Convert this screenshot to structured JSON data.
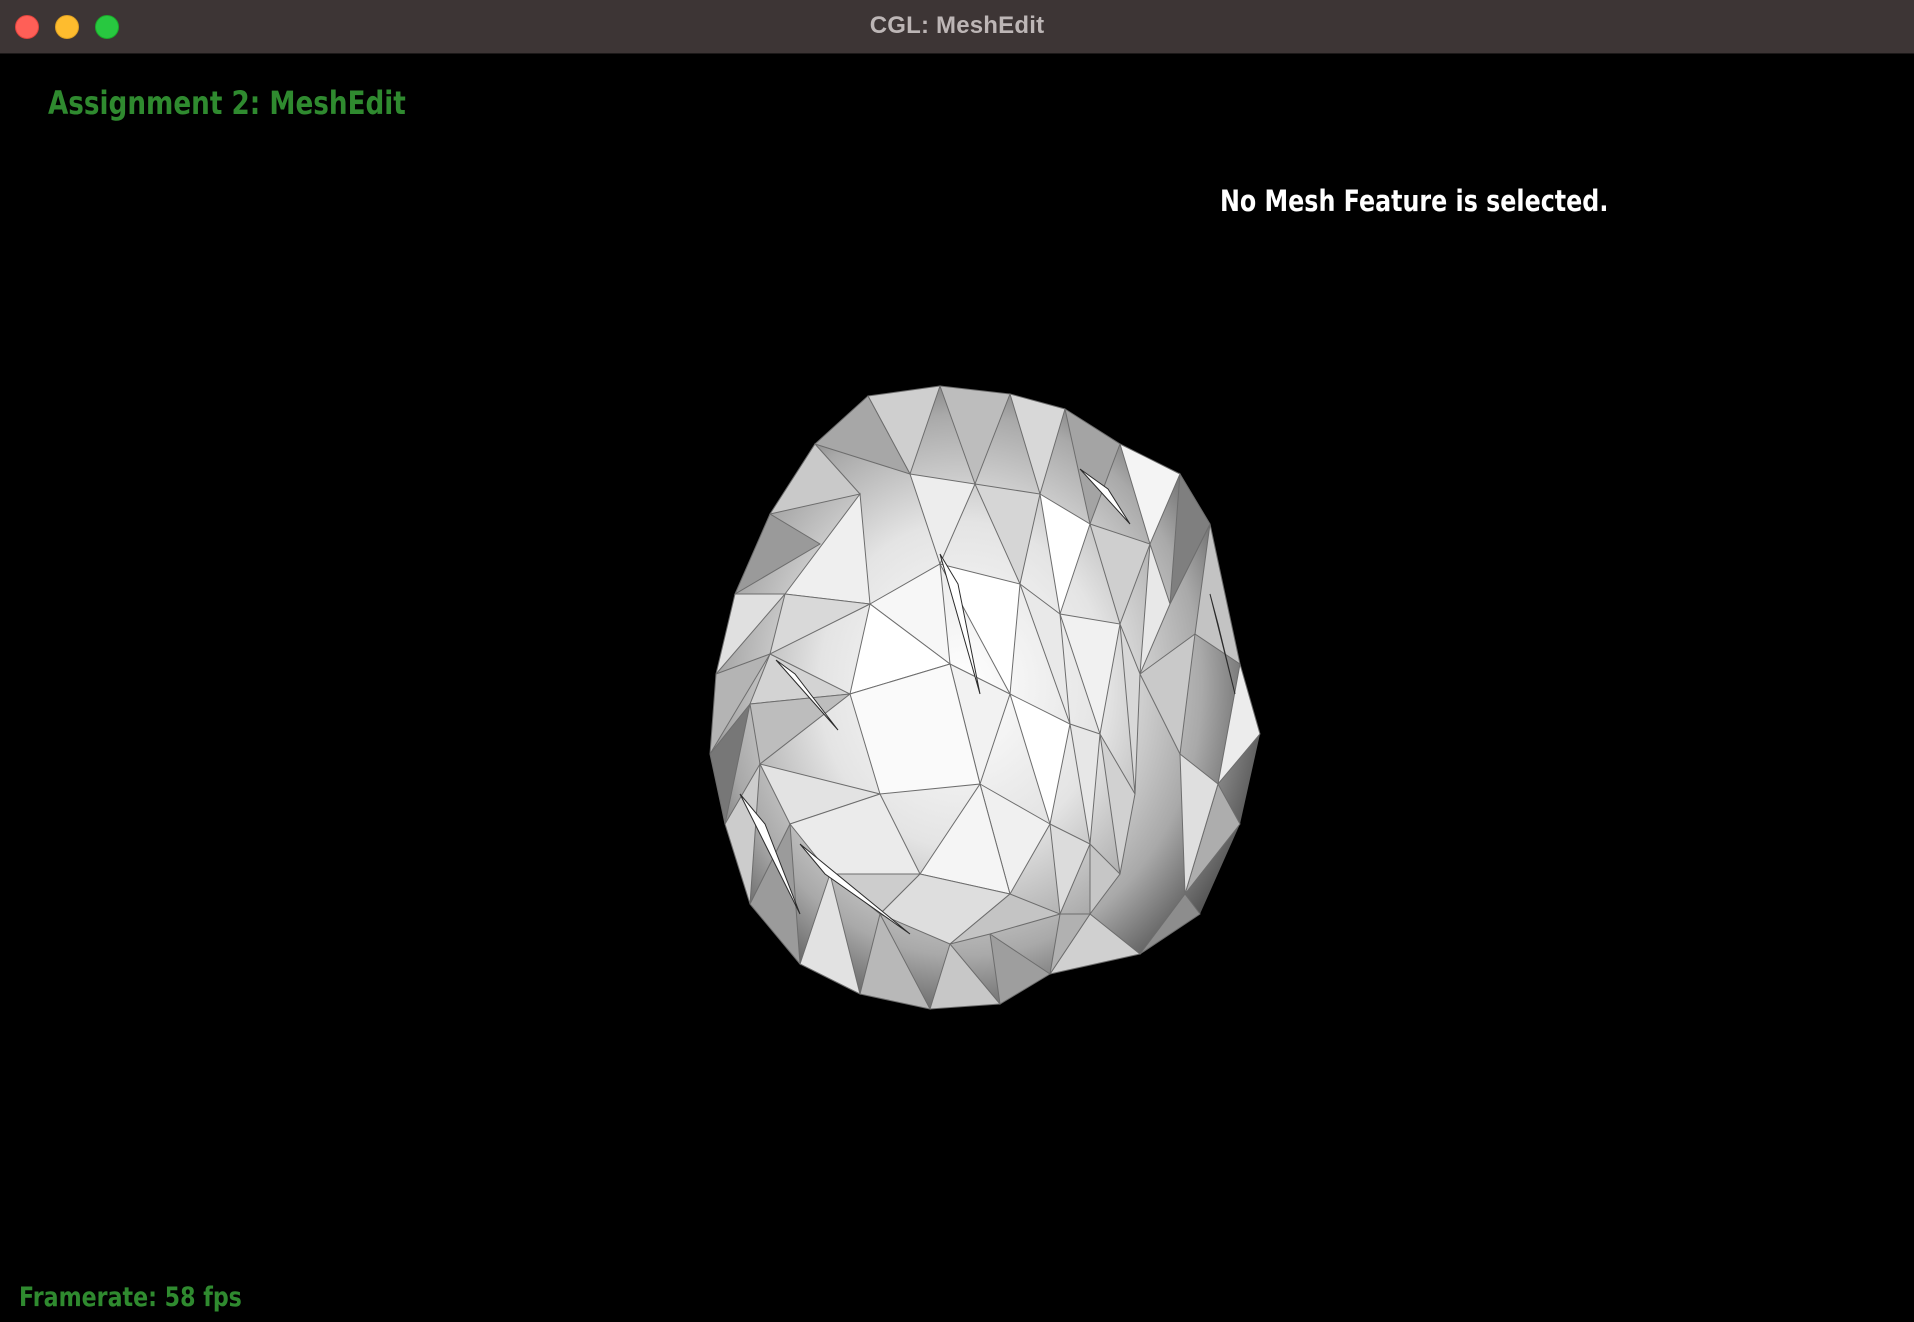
{
  "window": {
    "title": "CGL: MeshEdit"
  },
  "overlay": {
    "heading": "Assignment 2: MeshEdit",
    "feature_status": "No Mesh Feature is selected.",
    "framerate": "Framerate: 58 fps"
  },
  "colors": {
    "background": "#000000",
    "titlebar": "#3d3535",
    "heading_green": "#2f8a2f",
    "status_text": "#ffffff",
    "traffic_close": "#ff5f57",
    "traffic_minimize": "#febc2e",
    "traffic_maximize": "#28c840"
  }
}
